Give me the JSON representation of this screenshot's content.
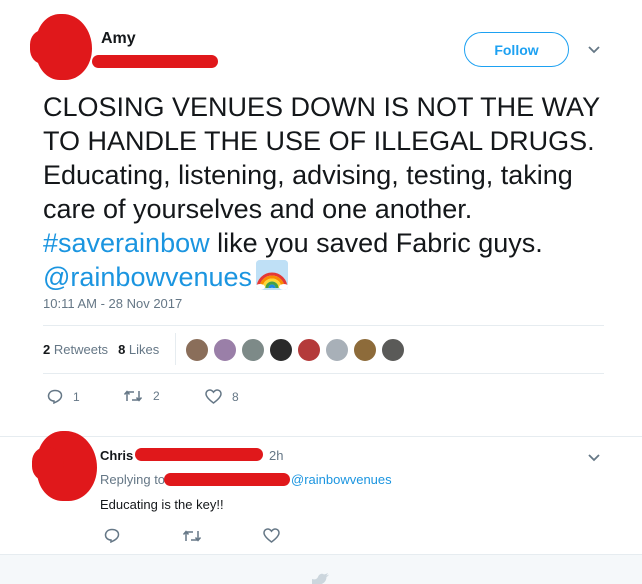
{
  "tweet": {
    "author_name": "Amy",
    "follow_label": "Follow",
    "text_line1": "CLOSING VENUES DOWN IS NOT THE WAY",
    "text_line2": "TO HANDLE THE USE OF ILLEGAL DRUGS.",
    "text_line3": "Educating, listening, advising, testing, taking",
    "text_line4": "care of yourselves and one another.",
    "hashtag": "#saverainbow",
    "text_line5_rest": " like you saved Fabric guys.",
    "mention": "@rainbowvenues",
    "emoji": "rainbow-emoji",
    "timestamp": "10:11 AM - 28 Nov 2017",
    "retweets_count": "2",
    "retweets_label": "Retweets",
    "likes_count": "8",
    "likes_label": "Likes",
    "actions": {
      "reply_count": "1",
      "retweet_count": "2",
      "like_count": "8"
    }
  },
  "reply": {
    "author_name": "Chris",
    "time": "2h",
    "replying_to": "Replying to",
    "replying_handle": "@rainbowvenues",
    "text": "Educating is the key!!"
  },
  "colors": {
    "accent": "#1da1f2",
    "link": "#1b95e0",
    "muted": "#657786",
    "redaction": "#e0181b"
  }
}
